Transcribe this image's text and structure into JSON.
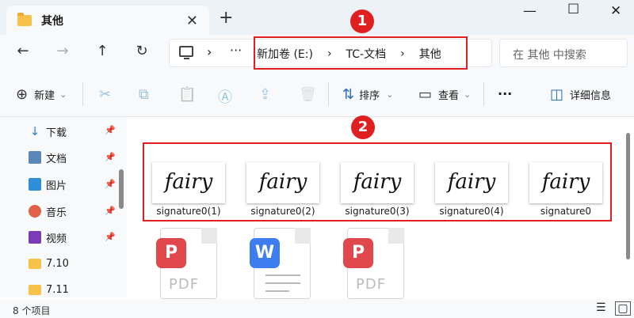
{
  "window": {
    "tab_title": "其他",
    "tab_close": "✕",
    "new_tab": "+",
    "minimize": "—",
    "maximize": "☐",
    "close": "✕"
  },
  "nav": {
    "back": "←",
    "forward": "→",
    "up": "↑",
    "refresh": "↻",
    "chevron": "›",
    "more": "···"
  },
  "breadcrumbs": [
    "新加卷 (E:)",
    "TC-文档",
    "其他"
  ],
  "breadcrumb_sep": "›",
  "search": {
    "placeholder": "在 其他 中搜索"
  },
  "toolbar": {
    "new_icon": "⊕",
    "new_label": "新建",
    "cut_icon": "✂",
    "copy_icon": "⧉",
    "paste_icon": "📋",
    "rename_icon": "Ⓐ",
    "share_icon": "⇪",
    "delete_icon": "🗑",
    "sort_icon": "⇅",
    "sort_label": "排序",
    "view_icon": "▭",
    "view_label": "查看",
    "more": "···",
    "details_icon": "◫",
    "details_label": "详细信息",
    "dropdown": "⌄"
  },
  "sidebar": {
    "items": [
      {
        "label": "下载",
        "pinned": true,
        "color": "#2a7fd4"
      },
      {
        "label": "文档",
        "pinned": true,
        "color": "#5b86b8"
      },
      {
        "label": "图片",
        "pinned": true,
        "color": "#2f8ed8"
      },
      {
        "label": "音乐",
        "pinned": true,
        "color": "#e0604a"
      },
      {
        "label": "视频",
        "pinned": true,
        "color": "#7a3db8"
      },
      {
        "label": "7.10",
        "pinned": false,
        "color": "#f7c24a"
      },
      {
        "label": "7.11",
        "pinned": false,
        "color": "#f7c24a"
      }
    ],
    "pin_icon": "📌"
  },
  "files": {
    "signatures": [
      {
        "name": "signature0(1)",
        "thumb_text": "fairy"
      },
      {
        "name": "signature0(2)",
        "thumb_text": "fairy"
      },
      {
        "name": "signature0(3)",
        "thumb_text": "fairy"
      },
      {
        "name": "signature0(4)",
        "thumb_text": "fairy"
      },
      {
        "name": "signature0",
        "thumb_text": "fairy"
      }
    ],
    "docs": [
      {
        "type": "PDF",
        "app_glyph": "P",
        "color": "#e0484d"
      },
      {
        "type": "W",
        "app_glyph": "W",
        "color": "#3d7df0"
      },
      {
        "type": "PDF",
        "app_glyph": "P",
        "color": "#e0484d"
      }
    ]
  },
  "annotations": {
    "badge1": "1",
    "badge2": "2"
  },
  "status": {
    "count": "8 个项目",
    "details_view": "☰",
    "thumb_view": "▢"
  }
}
